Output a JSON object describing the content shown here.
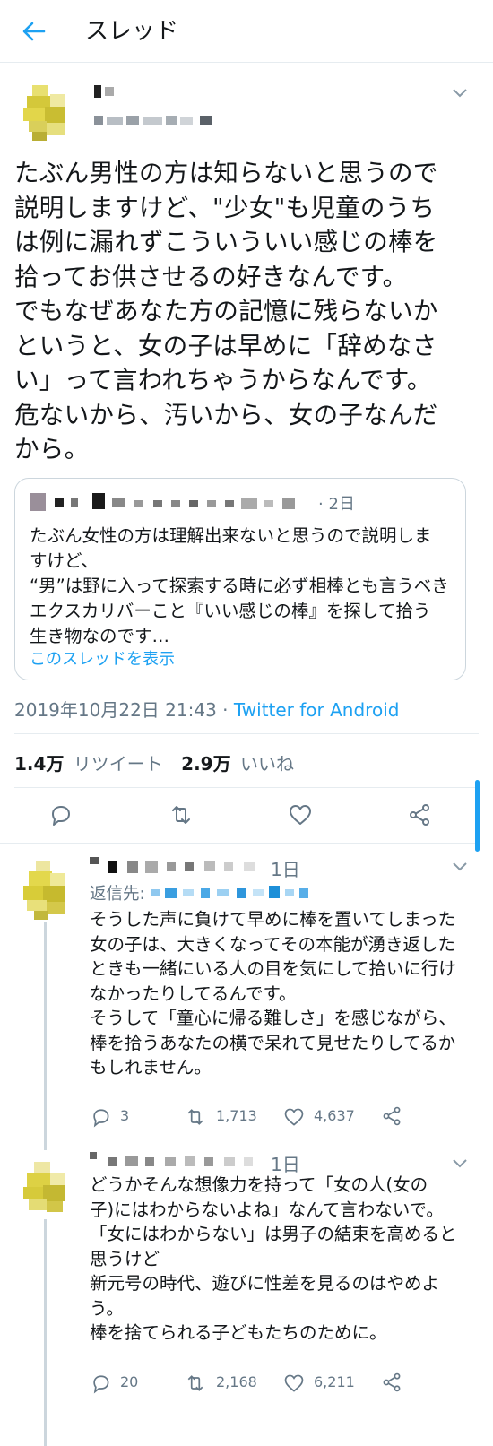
{
  "header": {
    "title": "スレッド"
  },
  "tweet": {
    "text": "たぶん男性の方は知らないと思うので\n説明しますけど、\"少女\"も児童のうち\nは例に漏れずこういういい感じの棒を\n拾ってお供させるの好きなんです。\nでもなぜあなた方の記憶に残らないか\nというと、女の子は早めに「辞めなさ\nい」って言われちゃうからなんです。\n危ないから、汚いから、女の子なんだ\nから。",
    "quote": {
      "time": "· 2日",
      "text": "たぶん女性の方は理解出来ないと思うので説明しま\nすけど、\n“男”は野に入って探索する時に必ず相棒とも言うべき\nエクスカリバーこと『いい感じの棒』を探して拾う\n生き物なのです…",
      "show_thread": "このスレッドを表示"
    },
    "timestamp": "2019年10月22日 21:43",
    "separator": " · ",
    "source": "Twitter for Android",
    "retweets_count": "1.4万",
    "retweets_label": "リツイート",
    "likes_count": "2.9万",
    "likes_label": "いいね"
  },
  "replies": [
    {
      "time": "1日",
      "replying_to": "返信先:",
      "text": "そうした声に負けて早めに棒を置いてしまった\n女の子は、大きくなってその本能が湧き返した\nときも一緒にいる人の目を気にして拾いに行け\nなかったりしてるんです。\nそうして「童心に帰る難しさ」を感じながら、\n棒を拾うあなたの横で呆れて見せたりしてるか\nもしれません。",
      "replies": "3",
      "retweets": "1,713",
      "likes": "4,637"
    },
    {
      "time": "1日",
      "text": "どうかそんな想像力を持って「女の人(女の\n子)にはわからないよね」なんて言わないで。\n「女にはわからない」は男子の結束を高めると\n思うけど\n新元号の時代、遊びに性差を見るのはやめよ\nう。\n棒を捨てられる子どもたちのために。",
      "replies": "20",
      "retweets": "2,168",
      "likes": "6,211"
    }
  ],
  "colors": {
    "accent": "#1da1f2",
    "secondary": "#657786",
    "text": "#14171a",
    "border": "#e6ecf0"
  },
  "icons": [
    "back-arrow-icon",
    "chevron-down-icon",
    "reply-icon",
    "retweet-icon",
    "like-icon",
    "share-icon"
  ]
}
